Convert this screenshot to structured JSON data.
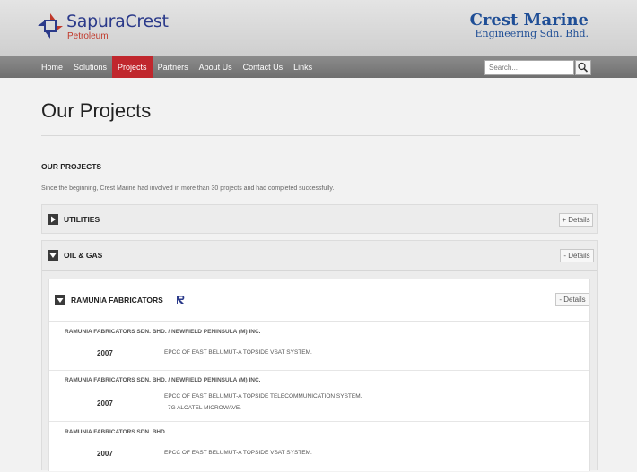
{
  "brand": {
    "left_name": "SapuraCrest",
    "left_sub": "Petroleum",
    "right_line1": "Crest Marine",
    "right_line2": "Engineering Sdn. Bhd."
  },
  "nav": {
    "items": [
      "Home",
      "Solutions",
      "Projects",
      "Partners",
      "About Us",
      "Contact Us",
      "Links"
    ],
    "active_index": 2
  },
  "search": {
    "placeholder": "Search..."
  },
  "page": {
    "title": "Our Projects",
    "section_heading": "OUR PROJECTS",
    "intro": "Since the beginning, Crest Marine had involved in more than 30 projects and had completed successfully."
  },
  "panels": {
    "utilities": {
      "label": "UTILITIES",
      "details_label": "+ Details"
    },
    "oil_gas": {
      "label": "OIL & GAS",
      "details_label": "- Details"
    }
  },
  "subpanel": {
    "label": "RAMUNIA FABRICATORS",
    "details_label": "- Details",
    "rows": [
      {
        "company": "RAMUNIA FABRICATORS SDN. BHD. / NEWFIELD PENINSULA (M) INC.",
        "year": "2007",
        "desc_line1": "EPCC OF EAST BELUMUT-A TOPSIDE VSAT SYSTEM.",
        "desc_line2": ""
      },
      {
        "company": "RAMUNIA FABRICATORS SDN. BHD. / NEWFIELD PENINSULA (M) INC.",
        "year": "2007",
        "desc_line1": "EPCC OF EAST BELUMUT-A TOPSIDE TELECOMMUNICATION SYSTEM.",
        "desc_line2": "- 7G ALCATEL MICROWAVE."
      },
      {
        "company": "RAMUNIA FABRICATORS SDN. BHD.",
        "year": "2007",
        "desc_line1": "EPCC OF EAST BELUMUT-A TOPSIDE VSAT SYSTEM.",
        "desc_line2": ""
      }
    ]
  },
  "colors": {
    "accent": "#c0272d",
    "brand_blue": "#2b3a8a",
    "nav_bg": "#7d7d7d"
  }
}
